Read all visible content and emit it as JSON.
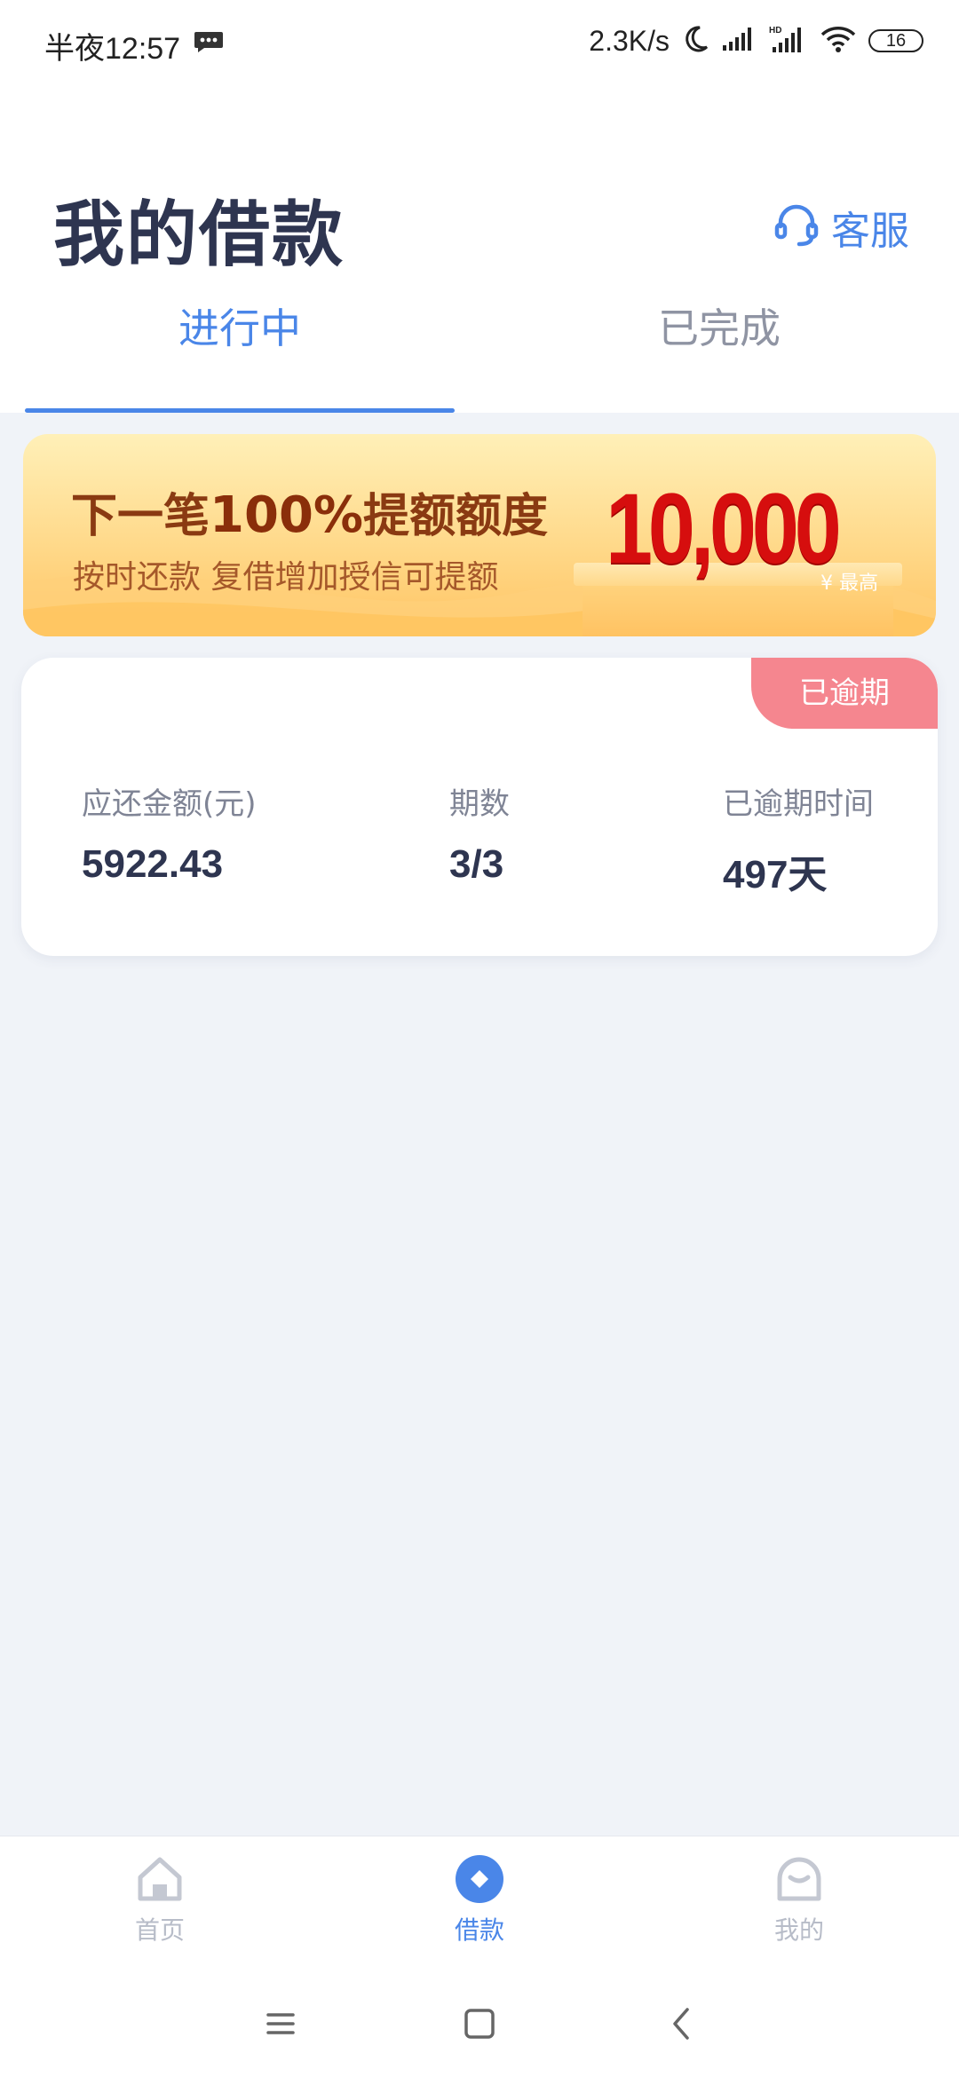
{
  "status_bar": {
    "time": "半夜12:57",
    "network_speed": "2.3K/s",
    "battery": "16",
    "icons": [
      "message-icon",
      "moon-icon",
      "signal-icon",
      "hd-signal-icon",
      "wifi-icon",
      "battery-icon"
    ]
  },
  "header": {
    "title": "我的借款",
    "service_label": "客服"
  },
  "tabs": [
    {
      "label": "进行中",
      "active": true
    },
    {
      "label": "已完成",
      "active": false
    }
  ],
  "banner": {
    "line1_prefix": "下一笔",
    "line1_percent": "100%",
    "line1_suffix": "提额额度",
    "line2": "按时还款  复借增加授信可提额",
    "amount": "10,000",
    "max_label": "¥ 最高"
  },
  "loan_card": {
    "badge": "已逾期",
    "stats": [
      {
        "label": "应还金额(元)",
        "value": "5922.43"
      },
      {
        "label": "期数",
        "value": "3/3"
      },
      {
        "label": "已逾期时间",
        "value": "497天"
      }
    ]
  },
  "bottom_nav": [
    {
      "label": "首页",
      "icon": "home-icon",
      "active": false
    },
    {
      "label": "借款",
      "icon": "loan-icon",
      "active": true
    },
    {
      "label": "我的",
      "icon": "profile-icon",
      "active": false
    }
  ],
  "colors": {
    "accent": "#4a86e8",
    "title": "#2e3550",
    "overdue": "#f5868f",
    "banner_amount": "#d60e0e",
    "background": "#f0f3f8"
  }
}
